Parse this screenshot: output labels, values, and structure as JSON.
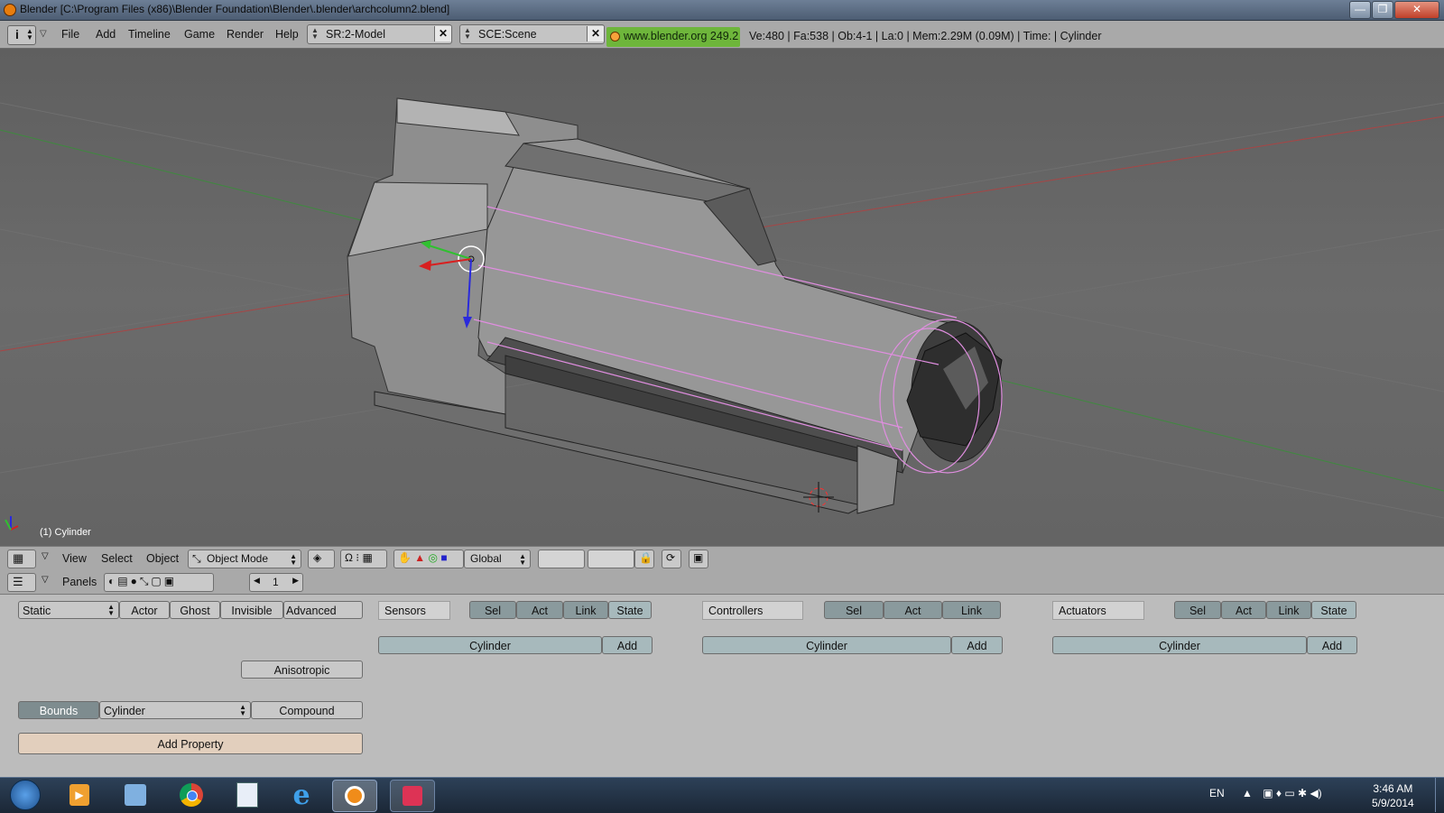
{
  "window": {
    "title": "Blender [C:\\Program Files (x86)\\Blender Foundation\\Blender\\.blender\\archcolumn2.blend]",
    "minimize": "—",
    "maximize": "❐",
    "close": "✕"
  },
  "topbar": {
    "menus": [
      "File",
      "Add",
      "Timeline",
      "Game",
      "Render",
      "Help"
    ],
    "screen": "SR:2-Model",
    "scene": "SCE:Scene",
    "url": "www.blender.org 249.2",
    "stats": "Ve:480 | Fa:538 | Ob:4-1 | La:0  | Mem:2.29M (0.09M)  | Time: | Cylinder"
  },
  "viewport": {
    "object_label": "(1) Cylinder"
  },
  "view_header": {
    "menus": [
      "View",
      "Select",
      "Object"
    ],
    "mode": "Object Mode",
    "orientation": "Global"
  },
  "buttons_header": {
    "panels_label": "Panels",
    "frame": "1"
  },
  "logic": {
    "physics_type": "Static",
    "actor": "Actor",
    "ghost": "Ghost",
    "invisible": "Invisible",
    "advanced": "Advanced",
    "anisotropic": "Anisotropic",
    "bounds": "Bounds",
    "bounds_type": "Cylinder",
    "compound": "Compound",
    "add_property": "Add Property",
    "sensors": {
      "title": "Sensors",
      "sel": "Sel",
      "act": "Act",
      "link": "Link",
      "state": "State",
      "object": "Cylinder",
      "add": "Add"
    },
    "controllers": {
      "title": "Controllers",
      "sel": "Sel",
      "act": "Act",
      "link": "Link",
      "object": "Cylinder",
      "add": "Add"
    },
    "actuators": {
      "title": "Actuators",
      "sel": "Sel",
      "act": "Act",
      "link": "Link",
      "state": "State",
      "object": "Cylinder",
      "add": "Add"
    }
  },
  "taskbar": {
    "language": "EN",
    "time": "3:46 AM",
    "date": "5/9/2014"
  }
}
